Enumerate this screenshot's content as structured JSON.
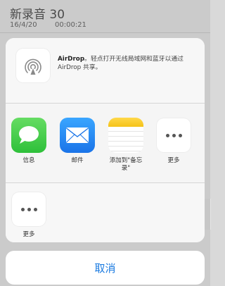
{
  "background": {
    "title": "新录音 30",
    "date": "16/4/20",
    "duration": "00:00:21"
  },
  "airdrop": {
    "icon": "airdrop-icon",
    "title": "AirDrop",
    "description": "。轻点打开无线局域网和蓝牙以通过 AirDrop 共享。"
  },
  "apps": [
    {
      "label": "信息",
      "icon": "messages-icon"
    },
    {
      "label": "邮件",
      "icon": "mail-icon"
    },
    {
      "label": "添加到\"备忘录\"",
      "icon": "notes-icon"
    },
    {
      "label": "更多",
      "icon": "more-icon"
    }
  ],
  "actions": [
    {
      "label": "更多",
      "icon": "more-icon"
    }
  ],
  "cancel_label": "取消",
  "colors": {
    "accent": "#1a7ae0",
    "messages_green": "#34c23f",
    "mail_blue": "#1f86f0",
    "notes_yellow": "#f5c318"
  }
}
